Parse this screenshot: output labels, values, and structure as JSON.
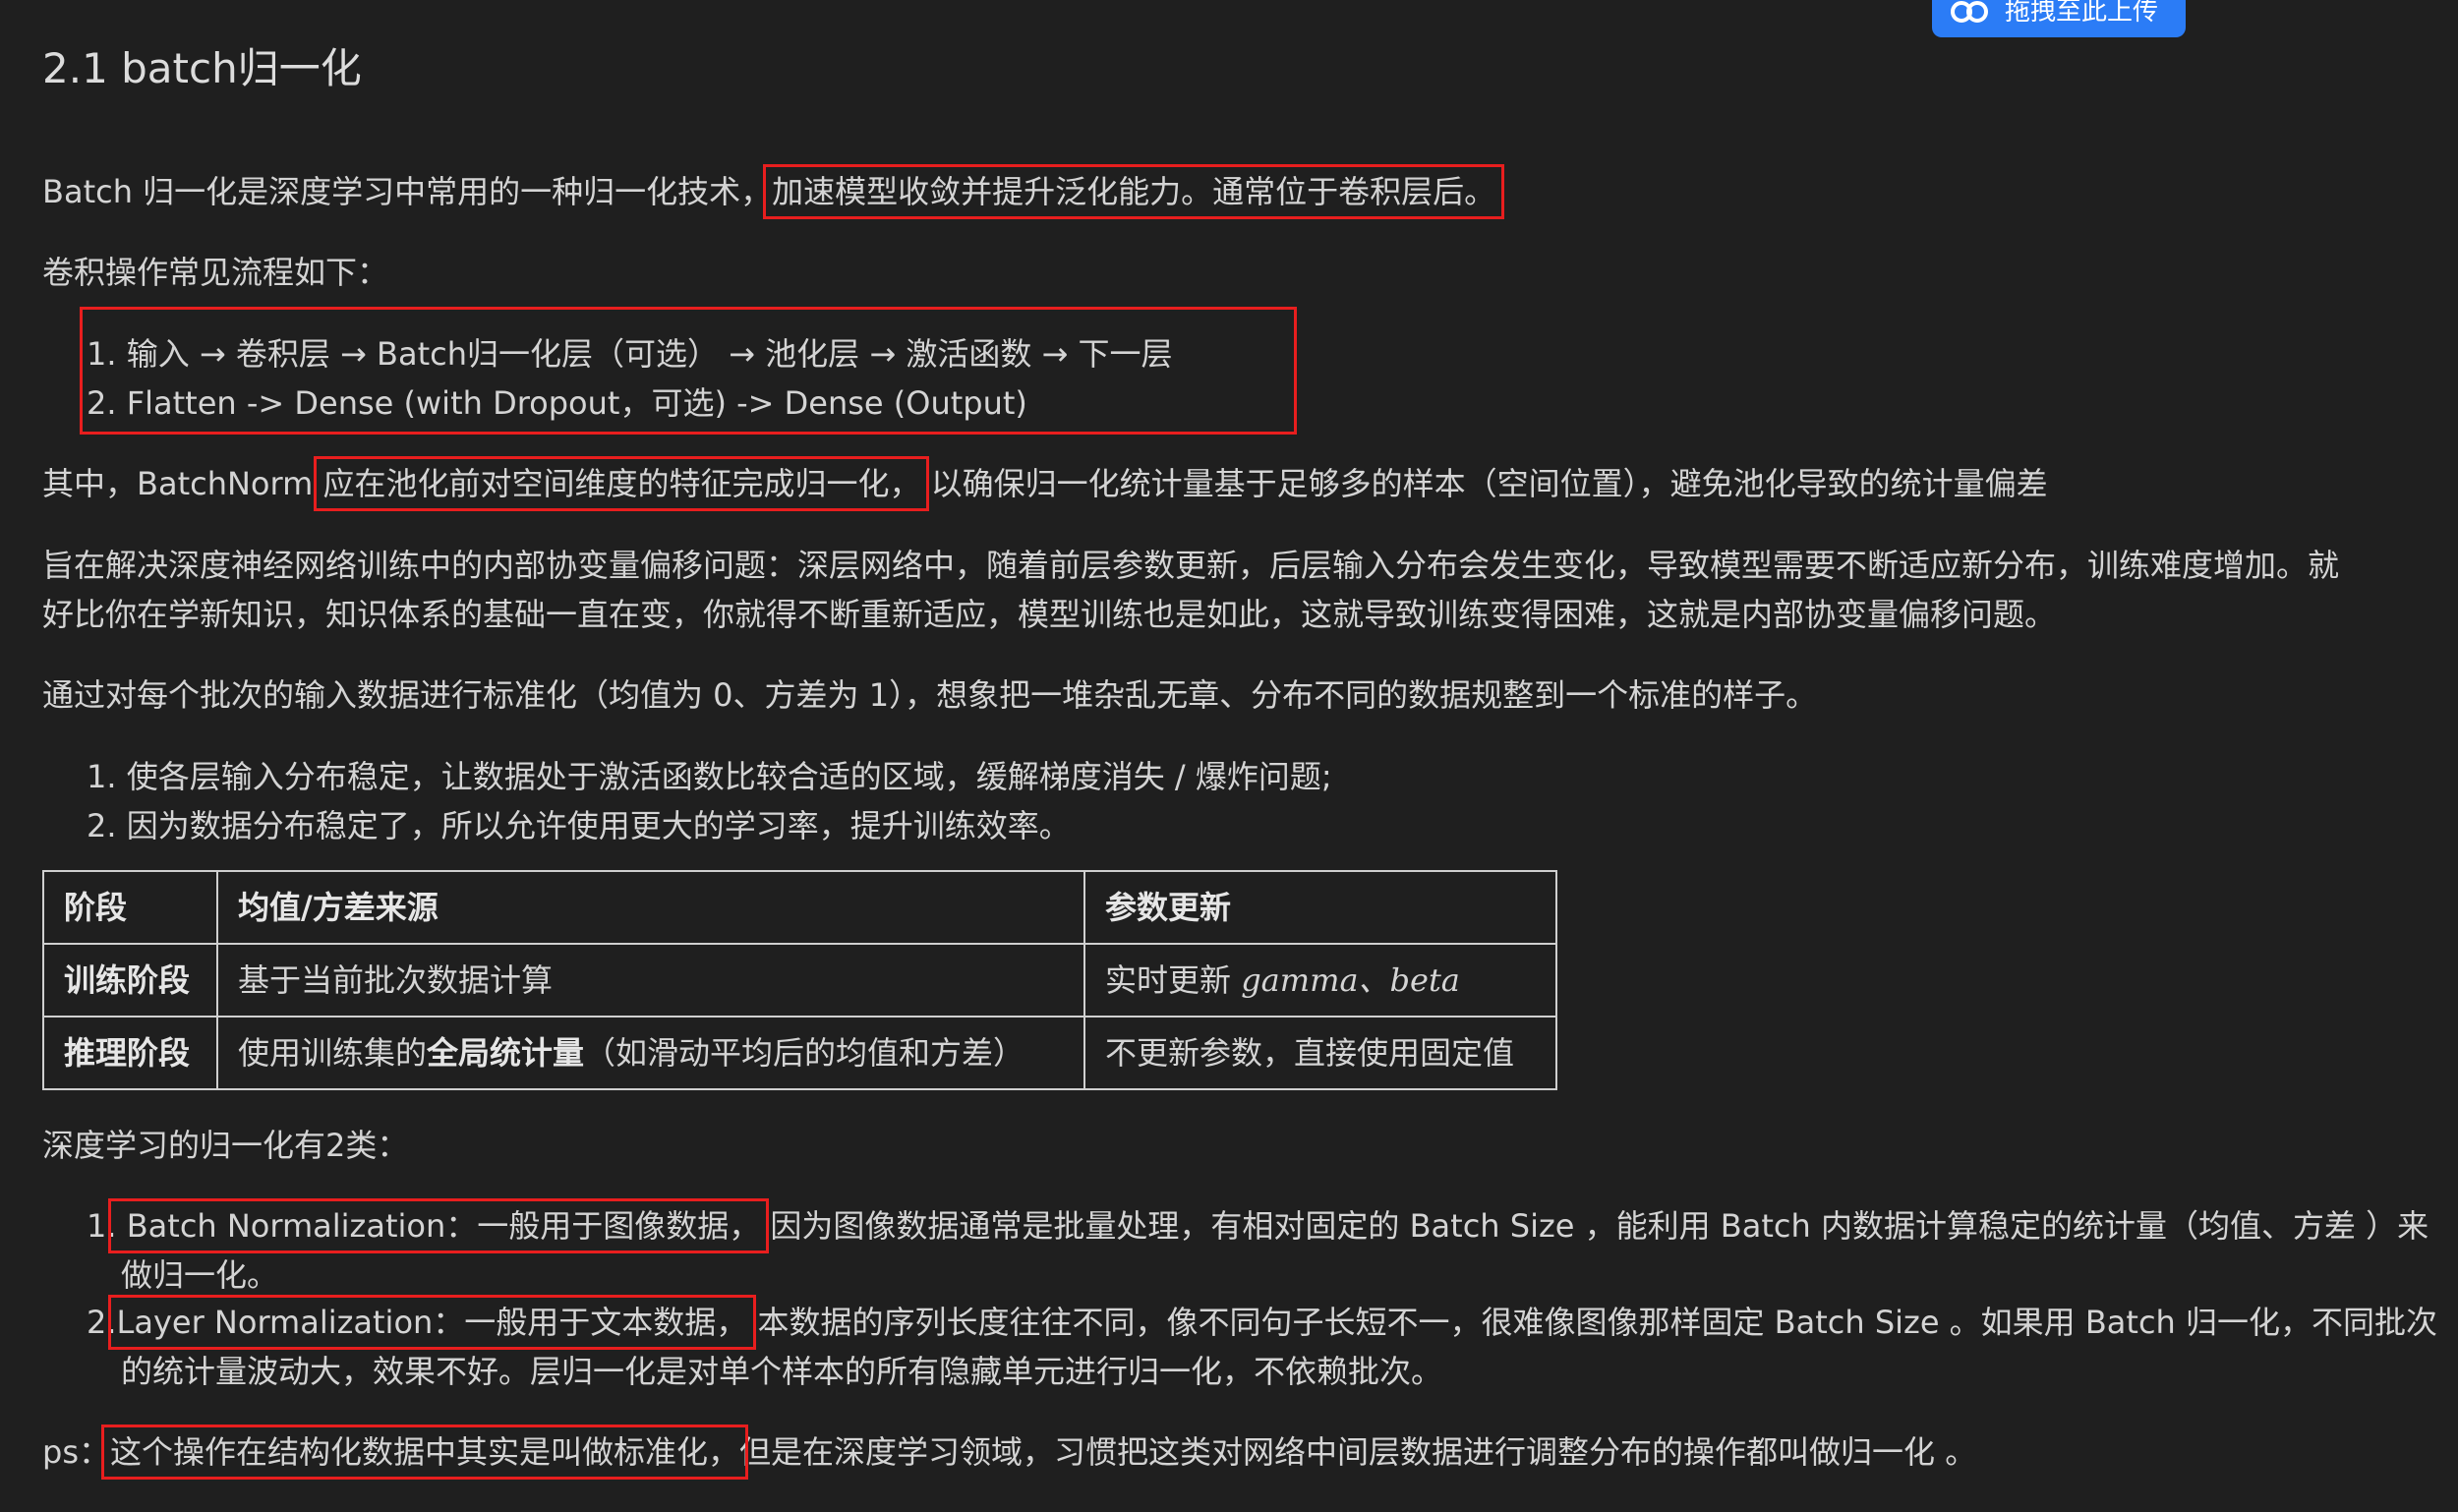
{
  "upload_button": {
    "label": "拖拽至此上传",
    "icon": "cloud-link-icon",
    "color": "#2b7cf6"
  },
  "title": "2.1 batch归一化",
  "para1": {
    "before": "Batch 归一化是深度学习中常用的一种归一化技术，",
    "highlight": "加速模型收敛并提升泛化能力。通常位于卷积层后。"
  },
  "flow_label": "卷积操作常见流程如下：",
  "flow_list": [
    "1. 输入 → 卷积层 → Batch归一化层（可选） → 池化层 → 激活函数 → 下一层",
    "2. Flatten -> Dense (with Dropout，可选) -> Dense (Output)"
  ],
  "para2": {
    "before": "其中，BatchNorm ",
    "highlight": "应在池化前对空间维度的特征完成归一化，",
    "after": " 以确保归一化统计量基于足够多的样本（空间位置），避免池化导致的统计量偏差"
  },
  "para3": {
    "line1": "旨在解决深度神经网络训练中的内部协变量偏移问题：深层网络中，随着前层参数更新，后层输入分布会发生变化，导致模型需要不断适应新分布，训练难度增加。就",
    "line2": "好比你在学新知识，知识体系的基础一直在变，你就得不断重新适应，模型训练也是如此，这就导致训练变得困难，这就是内部协变量偏移问题。"
  },
  "para4": "通过对每个批次的输入数据进行标准化（均值为 0、方差为 1），想象把一堆杂乱无章、分布不同的数据规整到一个标准的样子。",
  "benefits": [
    "1. 使各层输入分布稳定，让数据处于激活函数比较合适的区域，缓解梯度消失 / 爆炸问题;",
    "2. 因为数据分布稳定了，所以允许使用更大的学习率，提升训练效率。"
  ],
  "table": {
    "headers": [
      "阶段",
      "均值/方差来源",
      "参数更新"
    ],
    "rows": [
      {
        "stage": "训练阶段",
        "source": "基于当前批次数据计算",
        "update_text": "实时更新 ",
        "update_math": "gamma、beta"
      },
      {
        "stage": "推理阶段",
        "source_before": "使用训练集的",
        "source_bold": "全局统计量",
        "source_after": "（如滑动平均后的均值和方差）",
        "update": "不更新参数，直接使用固定值"
      }
    ]
  },
  "norm_label": "深度学习的归一化有2类：",
  "norm_list": [
    {
      "num": "1.",
      "highlight": " Batch Normalization：一般用于图像数据，",
      "rest_line1": "因为图像数据通常是批量处理，有相对固定的 Batch Size ，能利用 Batch 内数据计算稳定的统计量（均值、方差 ）来",
      "rest_line2": "做归一化。"
    },
    {
      "num": "2.",
      "highlight": "Layer Normalization：一般用于文本数据，",
      "rest_line1": "本数据的序列长度往往不同，像不同句子长短不一，很难像图像那样固定 Batch Size 。如果用 Batch 归一化，不同批次",
      "rest_line2": "的统计量波动大，效果不好。层归一化是对单个样本的所有隐藏单元进行归一化，不依赖批次。"
    }
  ],
  "ps": {
    "prefix": "ps：",
    "highlight": "这个操作在结构化数据中其实是叫做标准化，",
    "after": "但是在深度学习领域，习惯把这类对网络中间层数据进行调整分布的操作都叫做归一化 。"
  },
  "colors": {
    "background": "#1f1f1f",
    "text": "#d4d4d4",
    "highlight_box": "#e81e1e"
  }
}
